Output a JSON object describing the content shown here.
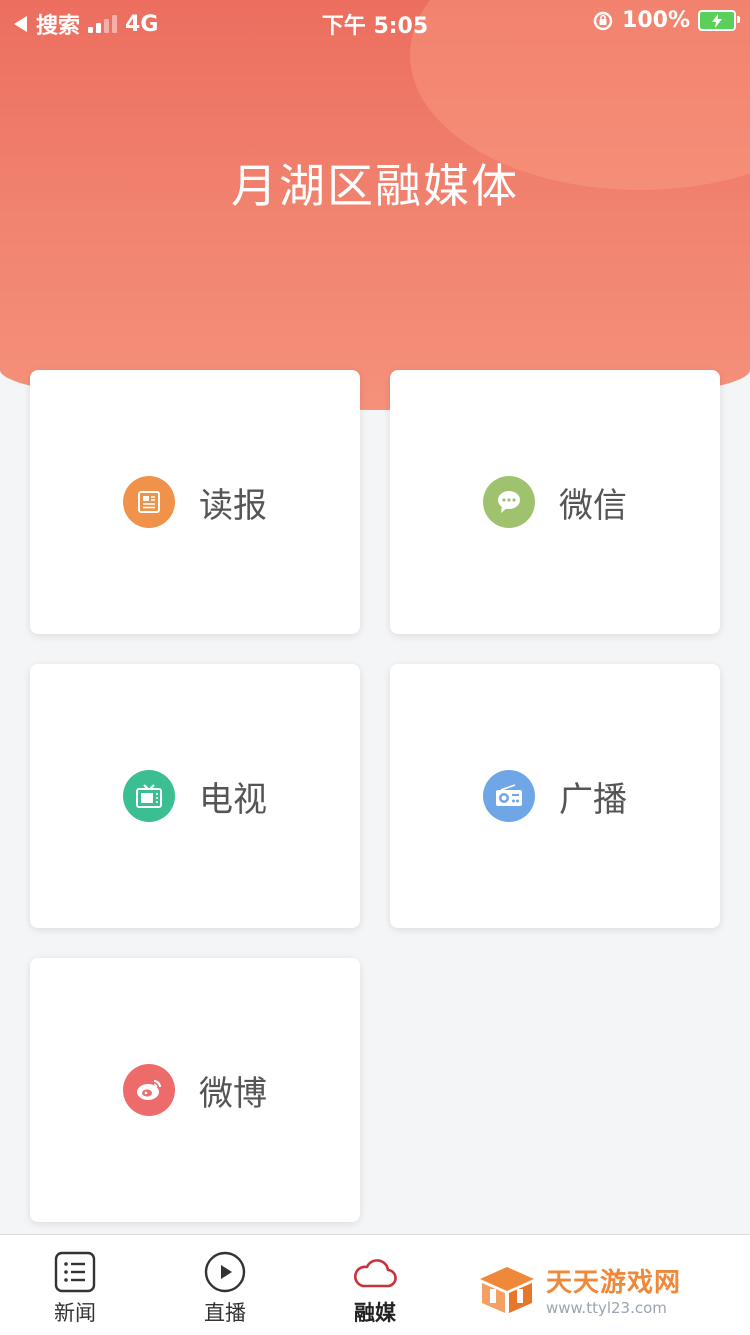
{
  "status_bar": {
    "back_label": "搜索",
    "network": "4G",
    "time": "下午 5:05",
    "battery": "100%"
  },
  "header": {
    "title": "月湖区融媒体"
  },
  "cards": [
    {
      "label": "读报",
      "icon": "newspaper-icon",
      "color": "#f0924a"
    },
    {
      "label": "微信",
      "icon": "wechat-icon",
      "color": "#9fc26f"
    },
    {
      "label": "电视",
      "icon": "tv-icon",
      "color": "#3bbf92"
    },
    {
      "label": "广播",
      "icon": "radio-icon",
      "color": "#6fa6e6"
    },
    {
      "label": "微博",
      "icon": "weibo-icon",
      "color": "#ee6b6b"
    }
  ],
  "tabbar": {
    "tabs": [
      {
        "label": "新闻",
        "icon": "list-icon",
        "active": false
      },
      {
        "label": "直播",
        "icon": "play-icon",
        "active": false
      },
      {
        "label": "融媒",
        "icon": "cloud-icon",
        "active": true
      }
    ],
    "active_color": "#c8323c"
  },
  "watermark": {
    "title": "天天游戏网",
    "url": "www.ttyl23.com"
  }
}
